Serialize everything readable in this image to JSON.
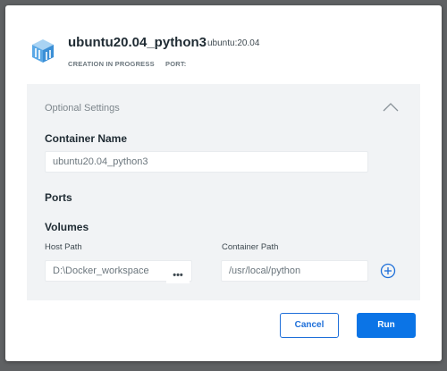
{
  "container": {
    "name": "ubuntu20.04_python3",
    "image": "ubuntu:20.04",
    "status": "CREATION IN PROGRESS",
    "port_label": "PORT:"
  },
  "settings": {
    "title": "Optional Settings",
    "container_name_label": "Container Name",
    "container_name_placeholder": "ubuntu20.04_python3",
    "ports_label": "Ports",
    "volumes_label": "Volumes",
    "host_path_label": "Host Path",
    "host_path_value": "D:\\Docker_workspace",
    "browse_label": "•••",
    "container_path_label": "Container Path",
    "container_path_value": "/usr/local/python"
  },
  "buttons": {
    "cancel": "Cancel",
    "run": "Run"
  },
  "colors": {
    "accent": "#0b74e6",
    "icon": "#5aa8e6"
  },
  "icons": {
    "container": "container-icon",
    "collapse": "chevron-up-icon",
    "add": "plus-circle-icon"
  }
}
